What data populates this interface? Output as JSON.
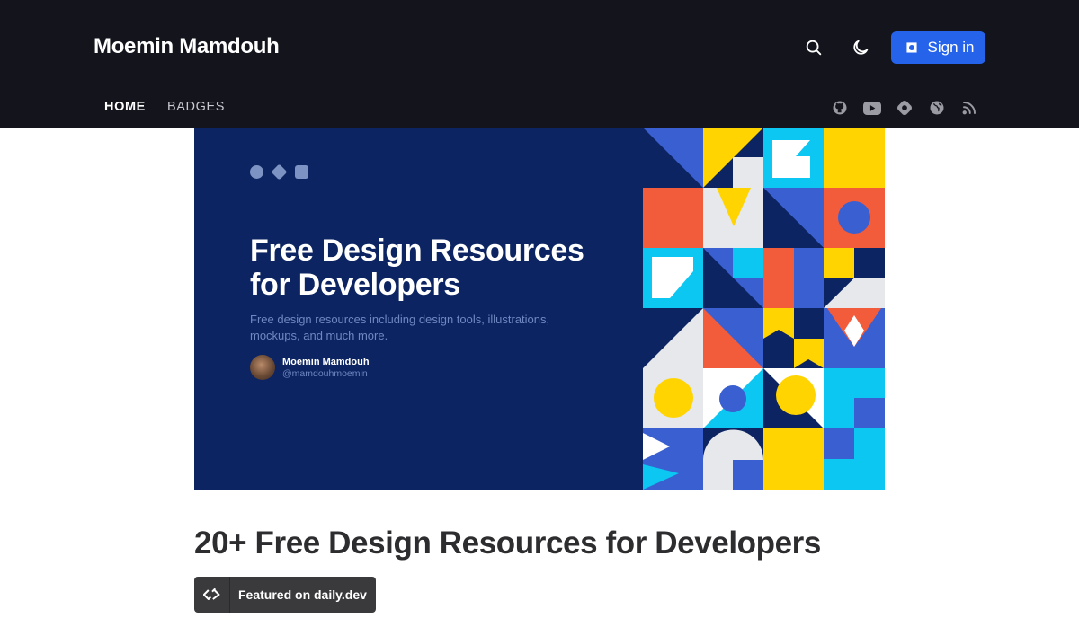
{
  "header": {
    "site_title": "Moemin Mamdouh",
    "sign_in_label": "Sign in",
    "accent_color": "#2563eb",
    "nav": [
      {
        "label": "HOME",
        "active": true
      },
      {
        "label": "BADGES",
        "active": false
      }
    ],
    "action_icons": [
      "search-icon",
      "moon-icon"
    ],
    "social_icons": [
      "github-icon",
      "youtube-icon",
      "hashnode-icon",
      "globe-icon",
      "rss-icon"
    ]
  },
  "hero": {
    "icons": [
      "twitter-icon",
      "hashnode-icon",
      "ih-icon"
    ],
    "title": "Free Design Resources for Developers",
    "subtitle": "Free design resources including design tools, illustrations, mockups, and much more.",
    "author_name": "Moemin Mamdouh",
    "author_handle": "@mamdouhmoemin",
    "background_color": "#0c2461"
  },
  "article": {
    "title": "20+ Free Design Resources for Developers",
    "badge_label": "Featured on daily.dev"
  }
}
